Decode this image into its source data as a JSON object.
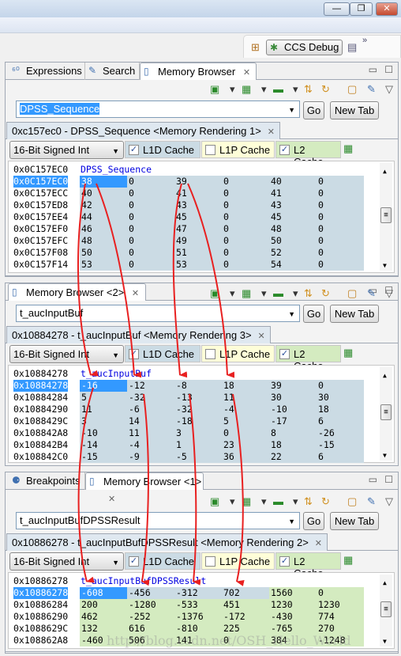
{
  "window": {
    "minimize": "—",
    "restore": "❐",
    "close": "✕"
  },
  "perspective": {
    "label": "CCS Debug",
    "more": "»"
  },
  "columns_count": 6,
  "colors": {
    "blue_cell": "#cbdbe4",
    "green_cell": "#d4ebc0",
    "l1d": "#cbdbe4",
    "l1p": "#fefed8",
    "l2": "#d4ebc0",
    "selection": "#3399ff",
    "arrow": "#e82020"
  },
  "panels": [
    {
      "tabs": [
        {
          "label": "Expressions",
          "icon": "expressions-icon"
        },
        {
          "label": "Search",
          "icon": "search-icon"
        },
        {
          "label": "Memory Browser",
          "icon": "memory-icon",
          "active": true,
          "close": "✕"
        }
      ],
      "address_input": "DPSS_Sequence",
      "go": "Go",
      "new_tab": "New Tab",
      "rendering_tab": "0xc157ec0 - DPSS_Sequence <Memory Rendering 1>",
      "format": "16-Bit Signed Int",
      "caches": [
        {
          "label": "L1D Cache",
          "checked": true
        },
        {
          "label": "L1P Cache",
          "checked": false
        },
        {
          "label": "L2 Cache",
          "checked": true
        }
      ],
      "label_row": {
        "addr": "0x0C157EC0",
        "label": "DPSS_Sequence"
      },
      "rows": [
        {
          "addr": "0x0C157EC0",
          "values": [
            "38",
            "0",
            "39",
            "0",
            "40",
            "0"
          ]
        },
        {
          "addr": "0x0C157ECC",
          "values": [
            "40",
            "0",
            "41",
            "0",
            "41",
            "0"
          ]
        },
        {
          "addr": "0x0C157ED8",
          "values": [
            "42",
            "0",
            "43",
            "0",
            "43",
            "0"
          ]
        },
        {
          "addr": "0x0C157EE4",
          "values": [
            "44",
            "0",
            "45",
            "0",
            "45",
            "0"
          ]
        },
        {
          "addr": "0x0C157EF0",
          "values": [
            "46",
            "0",
            "47",
            "0",
            "48",
            "0"
          ]
        },
        {
          "addr": "0x0C157EFC",
          "values": [
            "48",
            "0",
            "49",
            "0",
            "50",
            "0"
          ]
        },
        {
          "addr": "0x0C157F08",
          "values": [
            "50",
            "0",
            "51",
            "0",
            "52",
            "0"
          ]
        },
        {
          "addr": "0x0C157F14",
          "values": [
            "53",
            "0",
            "53",
            "0",
            "54",
            "0"
          ]
        }
      ]
    },
    {
      "tabs": [
        {
          "label": "Memory Browser <2>",
          "icon": "memory-icon",
          "active": true,
          "close": "✕"
        }
      ],
      "address_input": "t_aucInputBuf",
      "go": "Go",
      "new_tab": "New Tab",
      "rendering_tab": "0x10884278 - t_aucInputBuf <Memory Rendering 3>",
      "format": "16-Bit Signed Int",
      "caches": [
        {
          "label": "L1D Cache",
          "checked": true
        },
        {
          "label": "L1P Cache",
          "checked": false
        },
        {
          "label": "L2 Cache",
          "checked": true
        }
      ],
      "label_row": {
        "addr": "0x10884278",
        "label": "t_aucInputBuf"
      },
      "rows": [
        {
          "addr": "0x10884278",
          "values": [
            "-16",
            "-12",
            "-8",
            "18",
            "39",
            "0"
          ]
        },
        {
          "addr": "0x10884284",
          "values": [
            "5",
            "-32",
            "-13",
            "11",
            "30",
            "30"
          ]
        },
        {
          "addr": "0x10884290",
          "values": [
            "11",
            "-6",
            "-32",
            "-4",
            "-10",
            "18"
          ]
        },
        {
          "addr": "0x1088429C",
          "values": [
            "3",
            "14",
            "-18",
            "5",
            "-17",
            "6"
          ]
        },
        {
          "addr": "0x108842A8",
          "values": [
            "-10",
            "11",
            "3",
            "0",
            "8",
            "-26"
          ]
        },
        {
          "addr": "0x108842B4",
          "values": [
            "-14",
            "-4",
            "1",
            "23",
            "18",
            "-15"
          ]
        },
        {
          "addr": "0x108842C0",
          "values": [
            "-15",
            "-9",
            "-5",
            "36",
            "22",
            "6"
          ]
        }
      ]
    },
    {
      "tabs": [
        {
          "label": "Breakpoints",
          "icon": "breakpoints-icon"
        },
        {
          "label": "Memory Browser <1>",
          "icon": "memory-icon",
          "active": true,
          "close": "✕"
        }
      ],
      "address_input": "t_aucInputBufDPSSResult",
      "go": "Go",
      "new_tab": "New Tab",
      "rendering_tab": "0x10886278 - t_aucInputBufDPSSResult <Memory Rendering 2>",
      "format": "16-Bit Signed Int",
      "caches": [
        {
          "label": "L1D Cache",
          "checked": true
        },
        {
          "label": "L1P Cache",
          "checked": false
        },
        {
          "label": "L2 Cache",
          "checked": true
        }
      ],
      "label_row": {
        "addr": "0x10886278",
        "label": "t_aucInputBufDPSSResult"
      },
      "rows": [
        {
          "addr": "0x10886278",
          "values": [
            "-608",
            "-456",
            "-312",
            "702",
            "1560",
            "0"
          ]
        },
        {
          "addr": "0x10886284",
          "values": [
            "200",
            "-1280",
            "-533",
            "451",
            "1230",
            "1230"
          ]
        },
        {
          "addr": "0x10886290",
          "values": [
            "462",
            "-252",
            "-1376",
            "-172",
            "-430",
            "774"
          ]
        },
        {
          "addr": "0x1088629C",
          "values": [
            "132",
            "616",
            "-810",
            "225",
            "-765",
            "270"
          ]
        },
        {
          "addr": "0x108862A8",
          "values": [
            "-460",
            "506",
            "141",
            "0",
            "384",
            "-1248"
          ]
        }
      ]
    }
  ],
  "watermark": "http://blog.csdn.net/OSH_Hello_World"
}
